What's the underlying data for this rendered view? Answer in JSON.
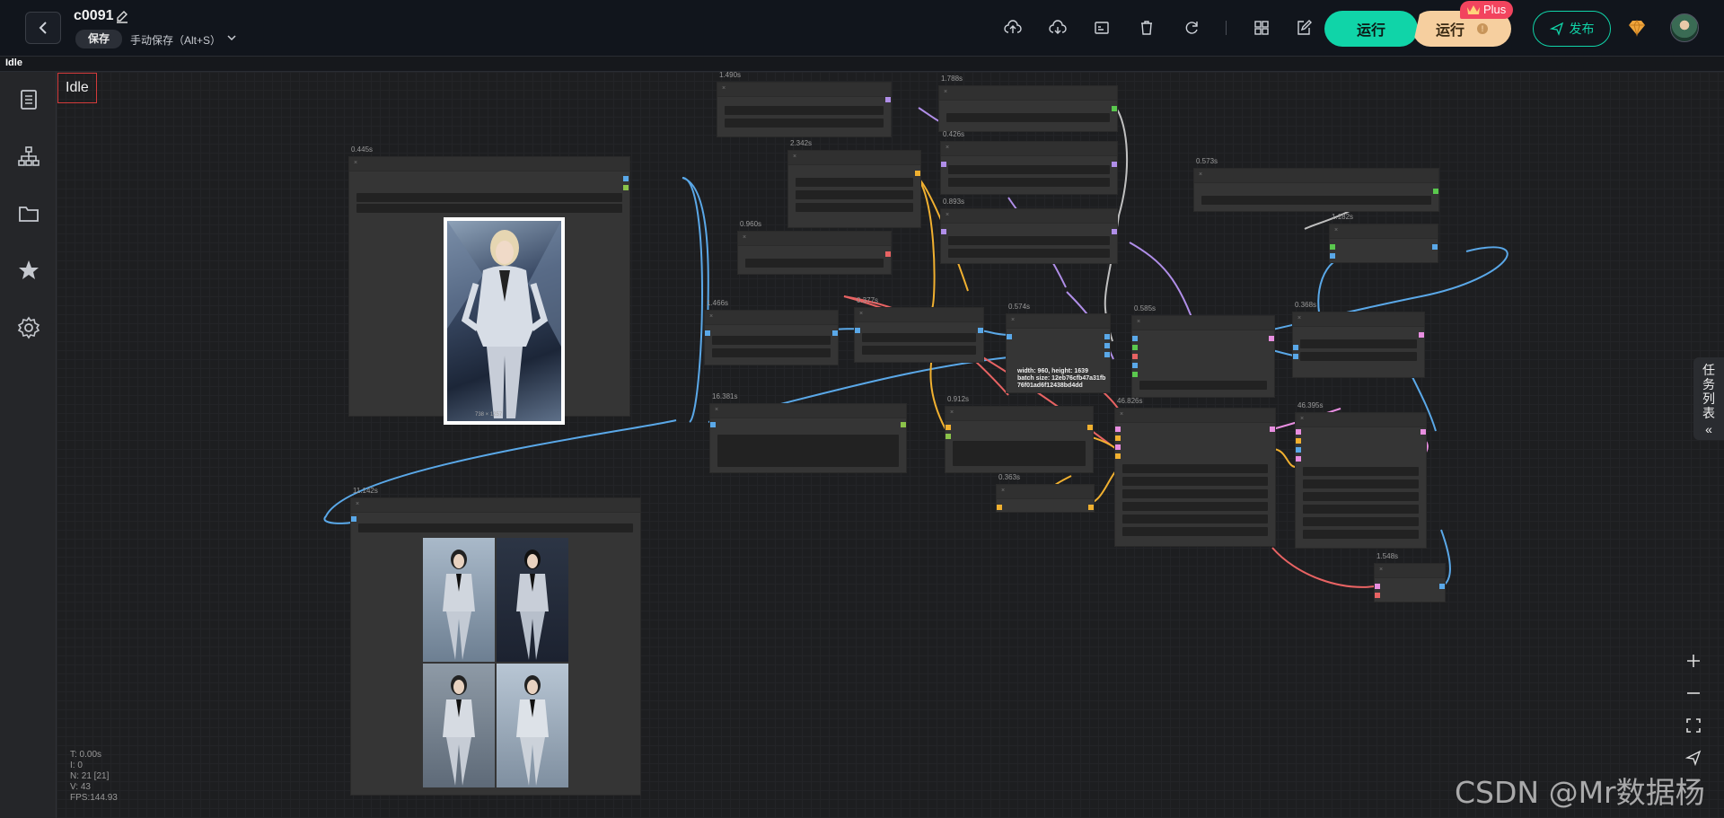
{
  "header": {
    "title": "c0091",
    "save_badge": "保存",
    "save_mode": "手动保存（Alt+S）",
    "run_label": "运行",
    "run_plus_label": "运行",
    "plus_badge": "Plus",
    "publish_label": "发布"
  },
  "subbar": {
    "status": "Idle"
  },
  "canvas": {
    "status": "Idle",
    "stats": {
      "t": "T: 0.00s",
      "i": "I: 0",
      "n": "N: 21 [21]",
      "v": "V: 43",
      "fps": "FPS:144.93"
    },
    "task_tab": "任务列表",
    "image_size_caption": "738 × 1257",
    "info_text": [
      "width: 960, height: 1639",
      "batch size: 12eb76cfb47a31fb",
      "76f01ad6f12438bd4dd"
    ]
  },
  "nodes": {
    "n1": "0.445s",
    "n2": "1.490s",
    "n3": "1.788s",
    "n4": "2.342s",
    "n5": "0.426s",
    "n6": "0.960s",
    "n7": "0.893s",
    "n8": "0.573s",
    "n9": "1.182s",
    "n10": "1.466s",
    "n11": "0.377s",
    "n12": "0.574s",
    "n13": "0.585s",
    "n14": "0.368s",
    "n15": "16.381s",
    "n16": "0.912s",
    "n17": "46.826s",
    "n18": "46.395s",
    "n19": "0.363s",
    "n20": "11.142s",
    "n21": "1.548s"
  },
  "watermark": "CSDN @Mr数据杨",
  "colors": {
    "accent": "#10d4a8",
    "plus": "#f6cf9f",
    "badge": "#f2445e"
  }
}
